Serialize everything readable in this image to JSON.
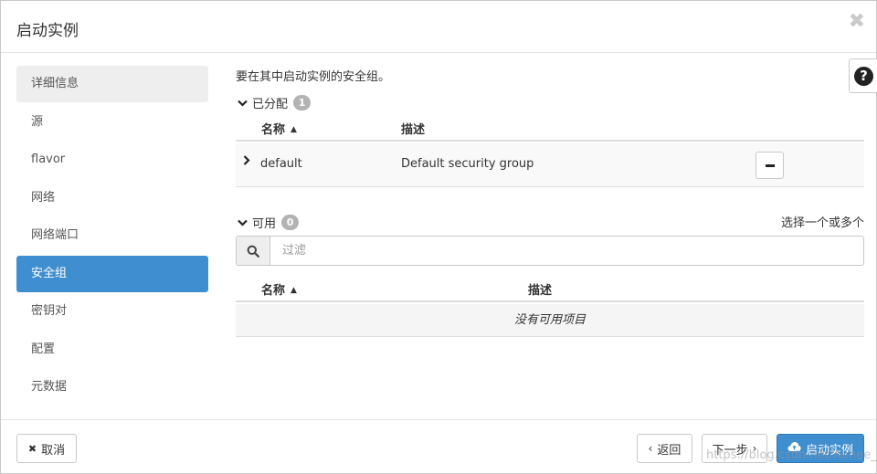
{
  "modal": {
    "title": "启动实例",
    "close_glyph": "✖"
  },
  "sidebar": {
    "items": [
      {
        "label": "详细信息"
      },
      {
        "label": "源"
      },
      {
        "label": "flavor"
      },
      {
        "label": "网络"
      },
      {
        "label": "网络端口"
      },
      {
        "label": "安全组"
      },
      {
        "label": "密钥对"
      },
      {
        "label": "配置"
      },
      {
        "label": "元数据"
      }
    ],
    "active_index": 5
  },
  "help": {
    "glyph": "?"
  },
  "content": {
    "description": "要在其中启动实例的安全组。",
    "allocated": {
      "label": "已分配",
      "count": "1",
      "columns": {
        "name": "名称",
        "description": "描述"
      },
      "rows": [
        {
          "name": "default",
          "description": "Default security group"
        }
      ]
    },
    "available": {
      "label": "可用",
      "count": "0",
      "select_hint": "选择一个或多个",
      "filter_placeholder": "过滤",
      "columns": {
        "name": "名称",
        "description": "描述"
      },
      "empty_text": "没有可用项目"
    }
  },
  "footer": {
    "cancel_label": "取消",
    "back_label": "返回",
    "next_label": "下一步",
    "launch_label": "启动实例"
  },
  "watermark": "https://blog.csdn.net/Aimee_c",
  "colors": {
    "accent": "#3f8ecf",
    "badge": "#b3b3b3"
  }
}
